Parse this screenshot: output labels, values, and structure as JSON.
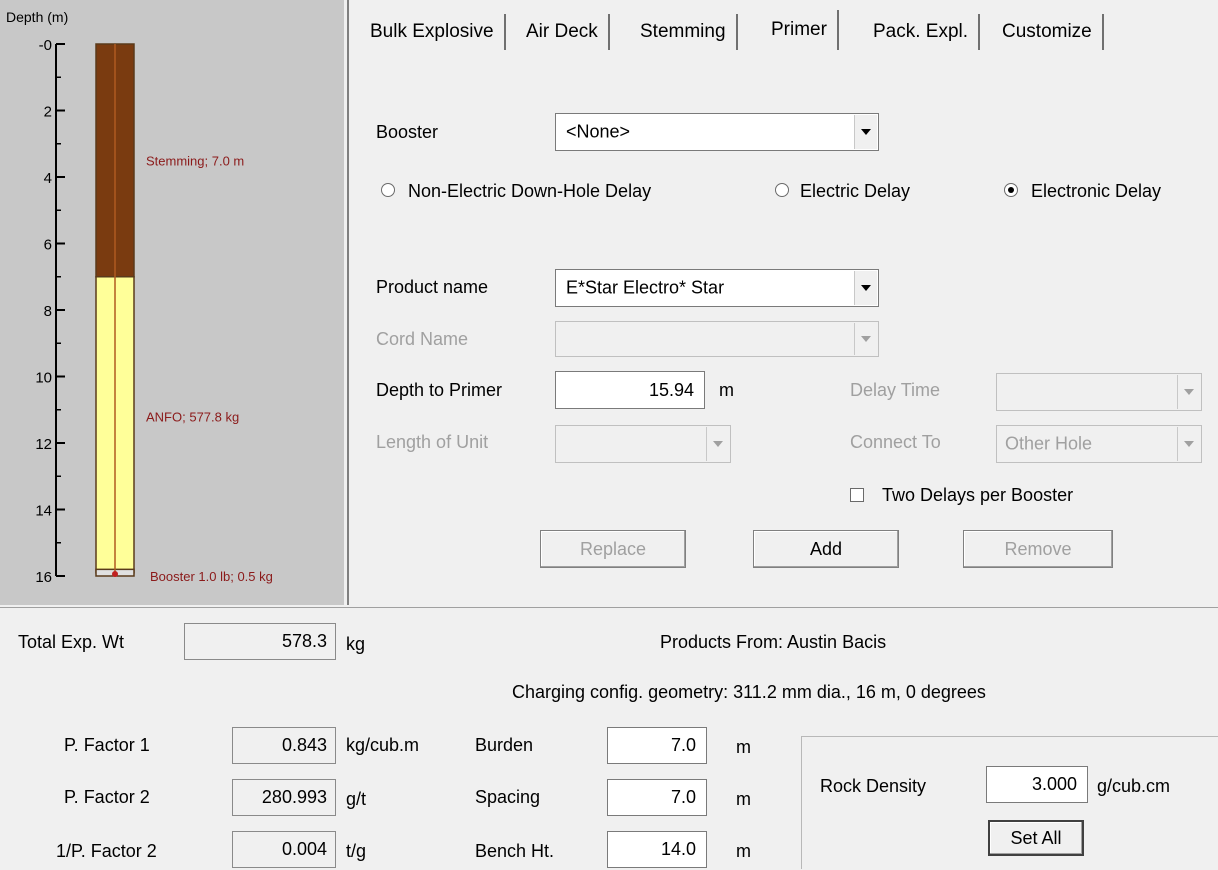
{
  "depth_chart": {
    "axis_title": "Depth (m)",
    "ticks": [
      "-0",
      "2",
      "4",
      "6",
      "8",
      "10",
      "12",
      "14",
      "16"
    ],
    "segments": [
      {
        "label": "Stemming; 7.0 m",
        "from": 0,
        "to": 7.0,
        "color": "#7a3b10"
      },
      {
        "label": "ANFO; 577.8 kg",
        "from": 7.0,
        "to": 15.9,
        "color": "#ffff99"
      },
      {
        "label": "Booster  1.0 lb; 0.5 kg",
        "from": 15.8,
        "to": 16.0,
        "color": "#e0e0e0"
      }
    ],
    "ymin": 0,
    "ymax": 16
  },
  "tabs": [
    {
      "label": "Bulk Explosive"
    },
    {
      "label": "Air Deck"
    },
    {
      "label": "Stemming"
    },
    {
      "label": "Primer"
    },
    {
      "label": "Pack. Expl."
    },
    {
      "label": "Customize"
    }
  ],
  "primer": {
    "booster_label": "Booster",
    "booster_value": "<None>",
    "radio_nonelectric": "Non-Electric Down-Hole Delay",
    "radio_electric": "Electric Delay",
    "radio_electronic": "Electronic Delay",
    "product_name_label": "Product name",
    "product_name_value": "E*Star Electro* Star",
    "cord_name_label": "Cord Name",
    "depth_to_primer_label": "Depth to Primer",
    "depth_to_primer_value": "15.94",
    "depth_unit": "m",
    "delay_time_label": "Delay Time",
    "length_of_unit_label": "Length of Unit",
    "connect_to_label": "Connect To",
    "connect_to_value": "Other Hole",
    "two_delays_label": "Two Delays per Booster",
    "replace_btn": "Replace",
    "add_btn": "Add",
    "remove_btn": "Remove"
  },
  "summary": {
    "total_exp_label": "Total Exp. Wt",
    "total_exp_value": "578.3",
    "total_exp_unit": "kg",
    "products_from": "Products From: Austin Bacis",
    "charging_config": "Charging config. geometry: 311.2 mm dia., 16 m, 0 degrees",
    "pf1_label": "P. Factor 1",
    "pf1_value": "0.843",
    "pf1_unit": "kg/cub.m",
    "pf2_label": "P. Factor 2",
    "pf2_value": "280.993",
    "pf2_unit": "g/t",
    "ipf2_label": "1/P. Factor 2",
    "ipf2_value": "0.004",
    "ipf2_unit": "t/g",
    "burden_label": "Burden",
    "burden_value": "7.0",
    "spacing_label": "Spacing",
    "spacing_value": "7.0",
    "bench_label": "Bench Ht.",
    "bench_value": "14.0",
    "m_unit": "m",
    "rock_density_label": "Rock Density",
    "rock_density_value": "3.000",
    "rock_density_unit": "g/cub.cm",
    "set_all_btn": "Set All"
  }
}
